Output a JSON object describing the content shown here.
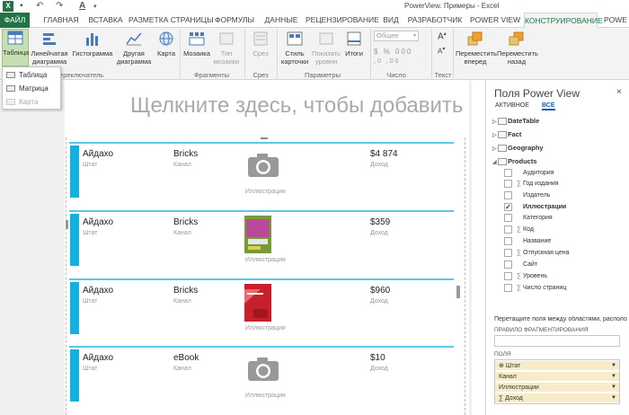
{
  "window": {
    "title": "PowerView. Примеры - Excel"
  },
  "tabs": [
    "ФАЙЛ",
    "ГЛАВНАЯ",
    "ВСТАВКА",
    "РАЗМЕТКА СТРАНИЦЫ",
    "ФОРМУЛЫ",
    "ДАННЫЕ",
    "РЕЦЕНЗИРОВАНИЕ",
    "ВИД",
    "РАЗРАБОТЧИК",
    "POWER VIEW",
    "КОНСТРУИРОВАНИЕ",
    "POWE"
  ],
  "ribbon": {
    "buttons": {
      "table": "Таблица",
      "line_chart": "Линейчатая диаграмма",
      "histogram": "Гистограмма",
      "other_chart": "Другая диаграмма",
      "map": "Карта",
      "tiles": "Мозаика",
      "tile_type": "Тип мозаики",
      "slicer": "Срез",
      "card_style": "Стиль карточки",
      "show_levels": "Показать уровни",
      "totals": "Итоги",
      "number_format": "Общее",
      "bring_forward": "Переместить вперед",
      "send_back": "Переместить назад"
    },
    "groups": {
      "switch": "Переключатель",
      "tiles": "Фрагменты",
      "slicer": "Срез",
      "params": "Параметры",
      "number": "Число",
      "text": "Текст"
    }
  },
  "dropdown": {
    "items": [
      "Таблица",
      "Матрица",
      "Карта"
    ]
  },
  "canvas": {
    "placeholder": "Щелкните здесь, чтобы добавить",
    "labels": {
      "state": "Штат",
      "channel": "Канал",
      "illustrations": "Иллюстрации",
      "income": "Доход"
    },
    "cards": [
      {
        "state": "Айдахо",
        "channel": "Bricks",
        "income": "$4 874",
        "image": "camera"
      },
      {
        "state": "Айдахо",
        "channel": "Bricks",
        "income": "$359",
        "image": "book-green"
      },
      {
        "state": "Айдахо",
        "channel": "Bricks",
        "income": "$960",
        "image": "book-red"
      },
      {
        "state": "Айдахо",
        "channel": "eBook",
        "income": "$10",
        "image": "camera"
      }
    ]
  },
  "pane": {
    "title": "Поля Power View",
    "tab_active": "АКТИВНОЕ",
    "tab_all": "ВСЕ",
    "tables": [
      "DateTable",
      "Fact",
      "Geography",
      "Products"
    ],
    "fields": [
      {
        "name": "Аудитория",
        "sigma": false,
        "checked": false
      },
      {
        "name": "Год издания",
        "sigma": true,
        "checked": false
      },
      {
        "name": "Издатель",
        "sigma": false,
        "checked": false
      },
      {
        "name": "Иллюстрации",
        "sigma": false,
        "checked": true
      },
      {
        "name": "Категория",
        "sigma": false,
        "checked": false
      },
      {
        "name": "Код",
        "sigma": true,
        "checked": false
      },
      {
        "name": "Название",
        "sigma": false,
        "checked": false
      },
      {
        "name": "Отпускная цена",
        "sigma": true,
        "checked": false
      },
      {
        "name": "Сайт",
        "sigma": false,
        "checked": false
      },
      {
        "name": "Уровень",
        "sigma": true,
        "checked": false
      },
      {
        "name": "Число страниц",
        "sigma": true,
        "checked": false
      }
    ],
    "drag_hint": "Перетащите поля между областями, расположенными ниже:",
    "zone_fragment": "ПРАВИЛО ФРАГМЕНТИРОВАНИЯ",
    "zone_fields": "ПОЛЯ",
    "field_items": [
      "Штат",
      "Канал",
      "Иллюстрации",
      "Доход"
    ]
  }
}
